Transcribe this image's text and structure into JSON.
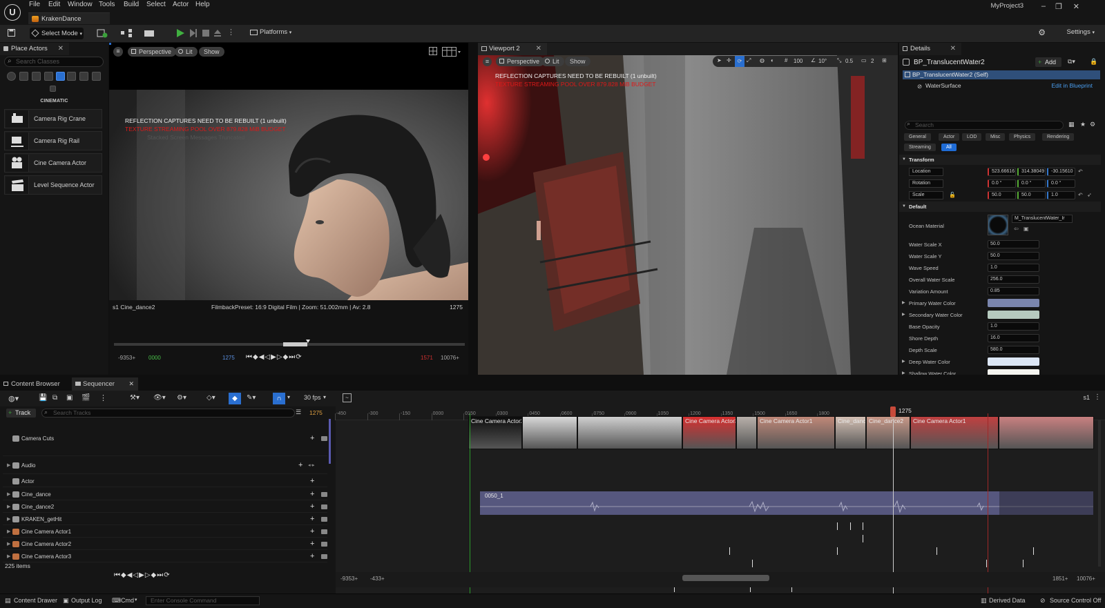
{
  "titlebar": {
    "menu": [
      "File",
      "Edit",
      "Window",
      "Tools",
      "Build",
      "Select",
      "Actor",
      "Help"
    ],
    "tab": "KrakenDance",
    "project": "MyProject3",
    "min_icon": "minimize-icon",
    "max_icon": "maximize-icon",
    "close_icon": "close-icon"
  },
  "toolbar": {
    "select_mode": "Select Mode",
    "platforms": "Platforms",
    "settings": "Settings"
  },
  "place_actors": {
    "tab": "Place Actors",
    "search_placeholder": "Search Classes",
    "category": "CINEMATIC",
    "items": [
      "Camera Rig Crane",
      "Camera Rig Rail",
      "Cine Camera Actor",
      "Level Sequence Actor"
    ]
  },
  "viewport1": {
    "perspective": "Perspective",
    "lit": "Lit",
    "show": "Show",
    "warn1": "REFLECTION CAPTURES NEED TO BE REBUILT (1 unbuilt)",
    "warn2": "TEXTURE STREAMING POOL OVER 879.828 MiB BUDGET",
    "warn3": "Stacked Screen Messages Truncated",
    "shot": "s1 Cine_dance2",
    "filmback": "FilmbackPreset: 16:9 Digital Film | Zoom: 51.002mm | Av: 2.8",
    "frame": "1275",
    "t_start": "-9353+",
    "t_in": "0000",
    "t_cur": "1275",
    "t_out": "1571",
    "t_end": "10076+"
  },
  "viewport2": {
    "tab": "Viewport 2",
    "perspective": "Perspective",
    "lit": "Lit",
    "show": "Show",
    "grid": "100",
    "angle": "10°",
    "scale": "0.5",
    "cam": "2",
    "warn1": "REFLECTION CAPTURES NEED TO BE REBUILT (1 unbuilt)",
    "warn2": "TEXTURE STREAMING POOL OVER 879.828 MiB BUDGET"
  },
  "details": {
    "tab": "Details",
    "actor": "BP_TranslucentWater2",
    "add": "Add",
    "self": "BP_TranslucentWater2 (Self)",
    "component": "WaterSurface",
    "edit_bp": "Edit in Blueprint",
    "search_placeholder": "Search",
    "filters": [
      "General",
      "Actor",
      "LOD",
      "Misc",
      "Physics",
      "Rendering",
      "Streaming",
      "All"
    ],
    "transform": "Transform",
    "location": {
      "label": "Location",
      "x": "523.66616",
      "y": "314.38049",
      "z": "-30.15610"
    },
    "rotation": {
      "label": "Rotation",
      "x": "0.0 °",
      "y": "0.0 °",
      "z": "0.0 °"
    },
    "scale": {
      "label": "Scale",
      "x": "50.0",
      "y": "50.0",
      "z": "1.0"
    },
    "default": "Default",
    "ocean_material_label": "Ocean Material",
    "ocean_material": "M_TranslucentWater_Ir",
    "props": [
      {
        "label": "Water Scale X",
        "value": "50.0"
      },
      {
        "label": "Water Scale Y",
        "value": "50.0"
      },
      {
        "label": "Wave Speed",
        "value": "1.0"
      },
      {
        "label": "Overall Water Scale",
        "value": "256.0"
      },
      {
        "label": "Variation Amount",
        "value": "0.85"
      },
      {
        "label": "Primary Water Color",
        "color": "#7a85ad"
      },
      {
        "label": "Secondary Water Color",
        "color": "#b6cabf"
      },
      {
        "label": "Base Opacity",
        "value": "1.0"
      },
      {
        "label": "Shore Depth",
        "value": "16.0"
      },
      {
        "label": "Depth Scale",
        "value": "580.0"
      },
      {
        "label": "Deep Water Color",
        "color": "#dce6f5"
      },
      {
        "label": "Shallow Water Color",
        "color": "#f4f4ef"
      }
    ]
  },
  "bottom": {
    "tab_content": "Content Browser",
    "tab_seq": "Sequencer",
    "fps": "30 fps",
    "seq_name": "s1",
    "add_track": "Track",
    "search_tracks": "Search Tracks",
    "current_frame": "1275",
    "tracks": [
      {
        "name": "Camera Cuts",
        "kind": "cuts"
      },
      {
        "name": "Audio",
        "kind": "audio"
      },
      {
        "name": "Actor",
        "kind": "folder"
      },
      {
        "name": "Cine_dance",
        "kind": "actor"
      },
      {
        "name": "Cine_dance2",
        "kind": "actor"
      },
      {
        "name": "KRAKEN_getHit",
        "kind": "actor"
      },
      {
        "name": "Cine Camera Actor1",
        "kind": "camera"
      },
      {
        "name": "Cine Camera Actor2",
        "kind": "camera"
      },
      {
        "name": "Cine Camera Actor3",
        "kind": "camera"
      }
    ],
    "items_count": "225 items",
    "ruler": [
      "-450",
      "-300",
      "-150",
      "0000",
      "0150",
      "0300",
      "0450",
      "0600",
      "0750",
      "0900",
      "1050",
      "1200",
      "1350",
      "1500",
      "1650",
      "1800"
    ],
    "playhead_label": "1275",
    "shots": [
      {
        "label": "Cine Camera Actor2",
        "color": "#0c0c0c"
      },
      {
        "label": "",
        "color": "#d8d8d8"
      },
      {
        "label": "",
        "color": "#cfcfcf"
      },
      {
        "label": "Cine Camera Actor3",
        "color": "#d83030"
      },
      {
        "label": "",
        "color": "#b8b0aa"
      },
      {
        "label": "Cine Camera Actor1",
        "color": "#c08878"
      },
      {
        "label": "Cine_danc",
        "color": "#d4c0b4"
      },
      {
        "label": "Cine_dance2",
        "color": "#c89888"
      },
      {
        "label": "Cine Camera Actor1",
        "color": "#c04040"
      },
      {
        "label": "",
        "color": "#c88080"
      }
    ],
    "audio_clip": "0050_1",
    "range_start": "-9353+",
    "range_in": "-433+",
    "range_out": "1851+",
    "range_end": "10076+"
  },
  "status": {
    "drawer": "Content Drawer",
    "output": "Output Log",
    "cmd": "Cmd",
    "console_placeholder": "Enter Console Command",
    "derived": "Derived Data",
    "source": "Source Control Off"
  }
}
